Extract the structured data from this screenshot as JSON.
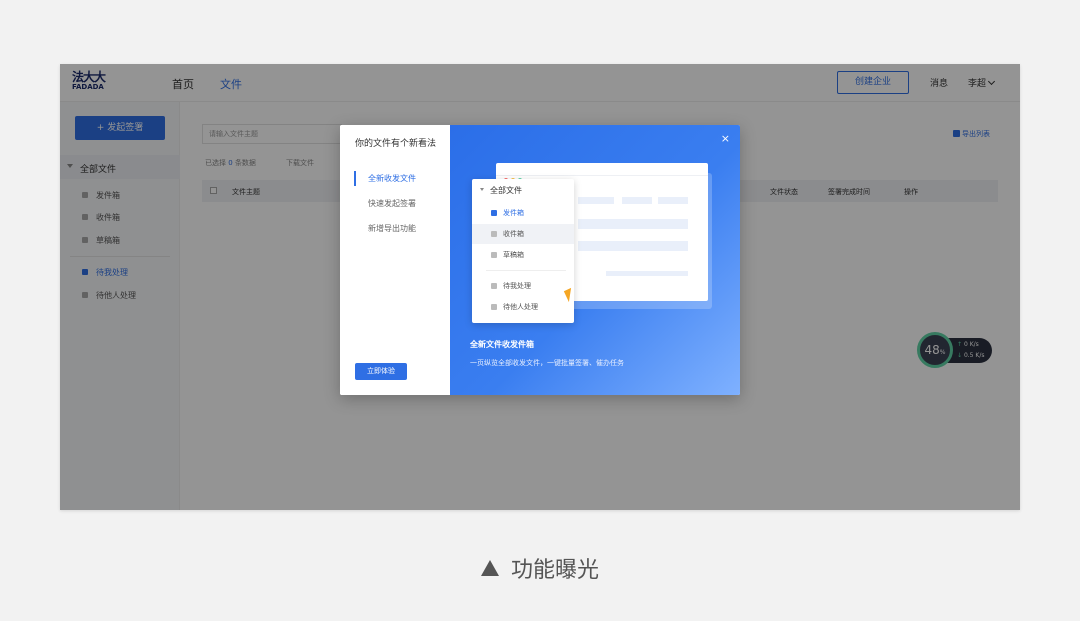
{
  "header": {
    "logo_zh": "法大大",
    "logo_en": "FADADA",
    "nav_home": "首页",
    "nav_files": "文件",
    "create_company": "创建企业",
    "messages": "消息",
    "user": "李超"
  },
  "sidebar": {
    "start_sign": "+ 发起签署",
    "all_files": "全部文件",
    "items": [
      "发件箱",
      "收件箱",
      "草稿箱"
    ],
    "tasks": [
      "待我处理",
      "待他人处理"
    ]
  },
  "content": {
    "search_placeholder": "请输入文件主题",
    "selected_prefix": "已选择",
    "selected_count": "0",
    "selected_suffix": "条数据",
    "download": "下载文件",
    "export": "导出列表",
    "columns": [
      "文件主题",
      "文件状态",
      "签署完成时间",
      "操作"
    ]
  },
  "speed": {
    "percent": "48",
    "percent_unit": "%",
    "up": "0",
    "up_unit": "K/s",
    "down": "0.5",
    "down_unit": "K/s"
  },
  "modal": {
    "title": "你的文件有个新看法",
    "menu": [
      "全新收发文件",
      "快速发起签署",
      "新增导出功能"
    ],
    "try_button": "立即体验",
    "close": "×",
    "feature_title": "全新文件收发件箱",
    "feature_desc": "一页纵览全部收发文件，一键批量签署、催办任务",
    "mock": {
      "all_files": "全部文件",
      "items": [
        "发件箱",
        "收件箱",
        "草稿箱"
      ],
      "tasks": [
        "待我处理",
        "待他人处理"
      ]
    }
  },
  "caption": "功能曝光",
  "colors": {
    "primary": "#2f6fe4",
    "speed_green": "#5fd3a6",
    "cursor": "#f5a623"
  }
}
